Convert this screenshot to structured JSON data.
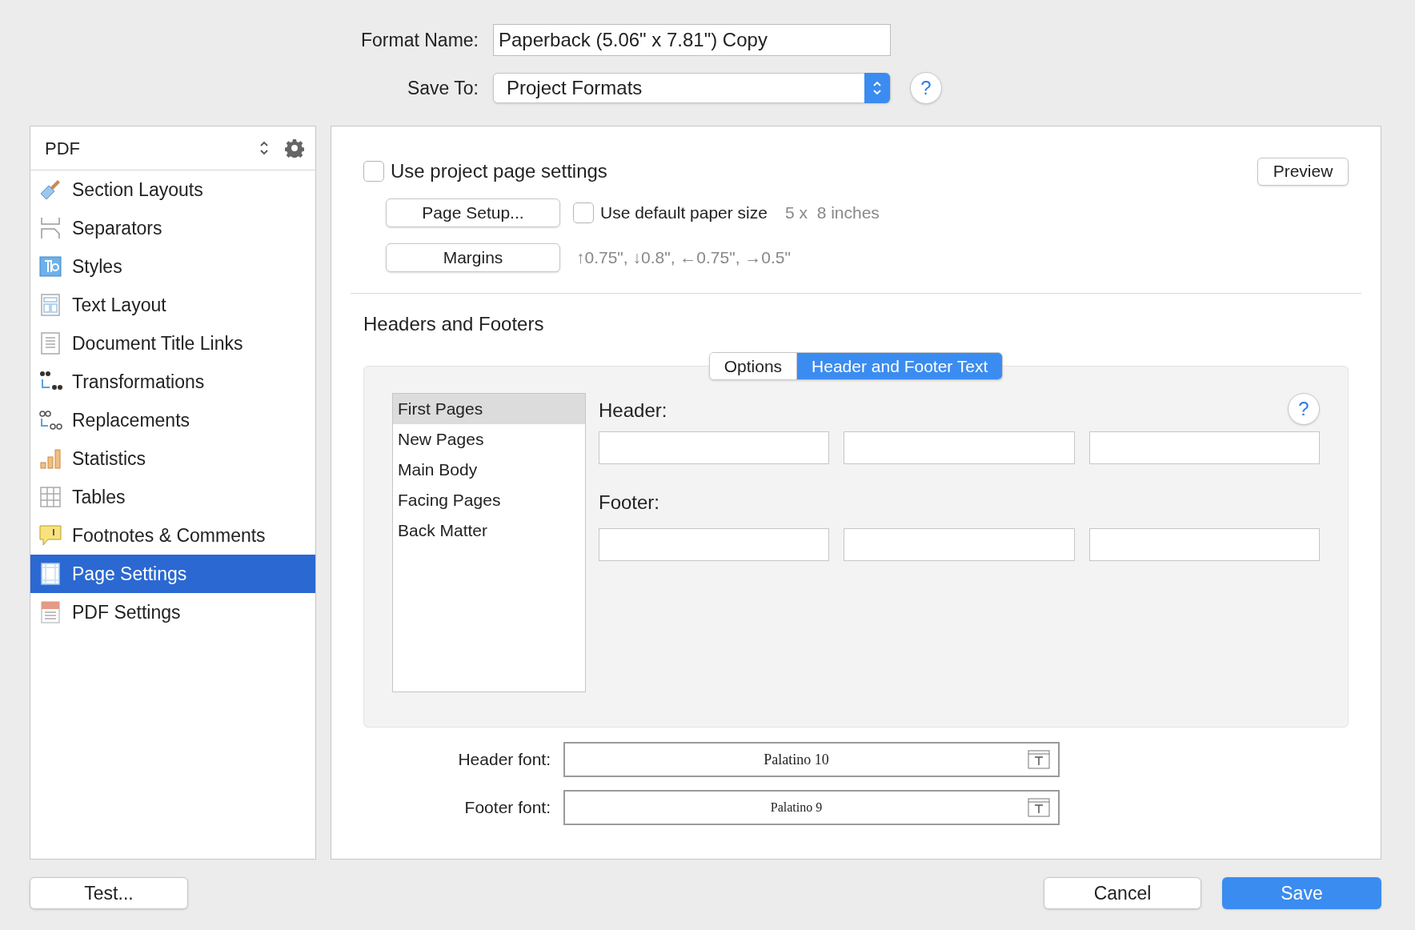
{
  "format_name": {
    "label": "Format Name:",
    "value": "Paperback (5.06\" x 7.81\") Copy"
  },
  "save_to": {
    "label": "Save To:",
    "value": "Project Formats",
    "help": "?"
  },
  "sidebar": {
    "format": "PDF",
    "items": [
      {
        "label": "Section Layouts",
        "selected": false
      },
      {
        "label": "Separators",
        "selected": false
      },
      {
        "label": "Styles",
        "selected": false
      },
      {
        "label": "Text Layout",
        "selected": false
      },
      {
        "label": "Document Title Links",
        "selected": false
      },
      {
        "label": "Transformations",
        "selected": false
      },
      {
        "label": "Replacements",
        "selected": false
      },
      {
        "label": "Statistics",
        "selected": false
      },
      {
        "label": "Tables",
        "selected": false
      },
      {
        "label": "Footnotes & Comments",
        "selected": false
      },
      {
        "label": "Page Settings",
        "selected": true
      },
      {
        "label": "PDF Settings",
        "selected": false
      }
    ]
  },
  "page": {
    "use_project_settings": {
      "label": "Use project page settings",
      "checked": false
    },
    "preview": "Preview",
    "page_setup": "Page Setup...",
    "default_paper": {
      "label": "Use default paper size",
      "checked": false
    },
    "paper_size": "5 x  8 inches",
    "margins_button": "Margins",
    "margins": "↑0.75\", ↓0.8\", ←0.75\", →0.5\""
  },
  "headers_footers": {
    "title": "Headers and Footers",
    "tabs": [
      {
        "label": "Options",
        "selected": false
      },
      {
        "label": "Header and Footer Text",
        "selected": true
      }
    ],
    "pages": [
      {
        "label": "First Pages",
        "selected": true
      },
      {
        "label": "New Pages",
        "selected": false
      },
      {
        "label": "Main Body",
        "selected": false
      },
      {
        "label": "Facing Pages",
        "selected": false
      },
      {
        "label": "Back Matter",
        "selected": false
      }
    ],
    "help": "?",
    "header_label": "Header:",
    "footer_label": "Footer:"
  },
  "fonts": [
    {
      "label": "Header font:",
      "value": "Palatino 10"
    },
    {
      "label": "Footer font:",
      "value": "Palatino 9"
    }
  ],
  "buttons": {
    "test": "Test...",
    "cancel": "Cancel",
    "save": "Save"
  }
}
